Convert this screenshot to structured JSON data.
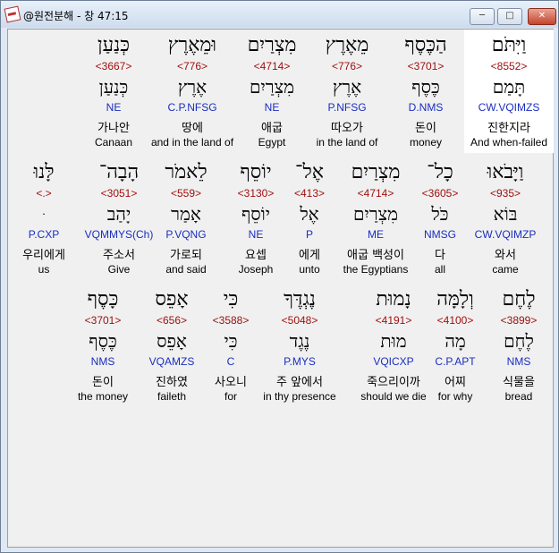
{
  "window": {
    "title": "@원전분해 - 창 47:15",
    "min_icon": "minimize-icon",
    "max_icon": "maximize-icon",
    "close_icon": "close-icon"
  },
  "rows": [
    {
      "words": [
        {
          "heb": "וַיִּתֹּם",
          "strong": "<8552>",
          "root": "תָּמַם",
          "parse": "CW.VQIMZS",
          "kor": "진한지라",
          "eng": "And when-failed",
          "highlighted": true
        },
        {
          "heb": "הַכֶּסֶף",
          "strong": "<3701>",
          "root": "כֶּסֶף",
          "parse": "D.NMS",
          "kor": "돈이",
          "eng": "money"
        },
        {
          "heb": "מֵאֶרֶץ",
          "strong": "<776>",
          "root": "אֶרֶץ",
          "parse": "P.NFSG",
          "kor": "따오가",
          "eng": "in the land of"
        },
        {
          "heb": "מִצְרַיִם",
          "strong": "<4714>",
          "root": "מִצְרַיִם",
          "parse": "NE",
          "kor": "애굽",
          "eng": "Egypt"
        },
        {
          "heb": "וּמֵאֶרֶץ",
          "strong": "<776>",
          "root": "אֶרֶץ",
          "parse": "C.P.NFSG",
          "kor": "땅에",
          "eng": "and in the land of"
        },
        {
          "heb": "כְּנַעַן",
          "strong": "<3667>",
          "root": "כְּנַעַן",
          "parse": "NE",
          "kor": "가나안",
          "eng": "Canaan"
        }
      ]
    },
    {
      "words": [
        {
          "heb": "וַיָּבֹאוּ",
          "strong": "<935>",
          "root": "בּוֹא",
          "parse": "CW.VQIMZP",
          "kor": "와서",
          "eng": "came"
        },
        {
          "heb": "כָל־",
          "strong": "<3605>",
          "root": "כֹּל",
          "parse": "NMSG",
          "kor": "다",
          "eng": "all"
        },
        {
          "heb": "מִצְרַיִם",
          "strong": "<4714>",
          "root": "מִצְרַיִם",
          "parse": "ME",
          "kor": "애굽 백성이",
          "eng": "the Egyptians"
        },
        {
          "heb": "אֶל־",
          "strong": "<413>",
          "root": "אֶל",
          "parse": "P",
          "kor": "에게",
          "eng": "unto"
        },
        {
          "heb": "יוֹסֵף",
          "strong": "<3130>",
          "root": "יוֹסֵף",
          "parse": "NE",
          "kor": "요셉",
          "eng": "Joseph"
        },
        {
          "heb": "לֵאמֹר",
          "strong": "<559>",
          "root": "אָמַר",
          "parse": "P.VQNG",
          "kor": "가로되",
          "eng": "and said"
        },
        {
          "heb": "הָבָה־",
          "strong": "<3051>",
          "root": "יָהַב",
          "parse": "VQMMYS(Ch)",
          "kor": "주소서",
          "eng": "Give"
        },
        {
          "heb": "לָּנוּ",
          "strong": "<.>",
          "root": "ּ",
          "parse": "P.CXP",
          "kor": "우리에게",
          "eng": "us"
        }
      ]
    },
    {
      "words": [
        {
          "heb": "לֶחֶם",
          "strong": "<3899>",
          "root": "לֶחֶם",
          "parse": "NMS",
          "kor": "식물을",
          "eng": "bread"
        },
        {
          "heb": "וְלָמָּה",
          "strong": "<4100>",
          "root": "מָה",
          "parse": "C.P.APT",
          "kor": "어찌",
          "eng": "for why"
        },
        {
          "heb": "נָמוּת",
          "strong": "<4191>",
          "root": "מוּת",
          "parse": "VQICXP",
          "kor": "죽으리이까",
          "eng": "should we die"
        },
        {
          "heb": "נֶגְדֶּךָ",
          "strong": "<5048>",
          "root": "נֶגֶד",
          "parse": "P.MYS",
          "kor": "주 앞에서",
          "eng": "in thy presence"
        },
        {
          "heb": "כִּי",
          "strong": "<3588>",
          "root": "כִּי",
          "parse": "C",
          "kor": "사오니",
          "eng": "for"
        },
        {
          "heb": "אָפֵס",
          "strong": "<656>",
          "root": "אָפֵס",
          "parse": "VQAMZS",
          "kor": "진하였",
          "eng": "faileth"
        },
        {
          "heb": "כָּסֶף",
          "strong": "<3701>",
          "root": "כֶּסֶף",
          "parse": "NMS",
          "kor": "돈이",
          "eng": "the money"
        }
      ]
    }
  ]
}
